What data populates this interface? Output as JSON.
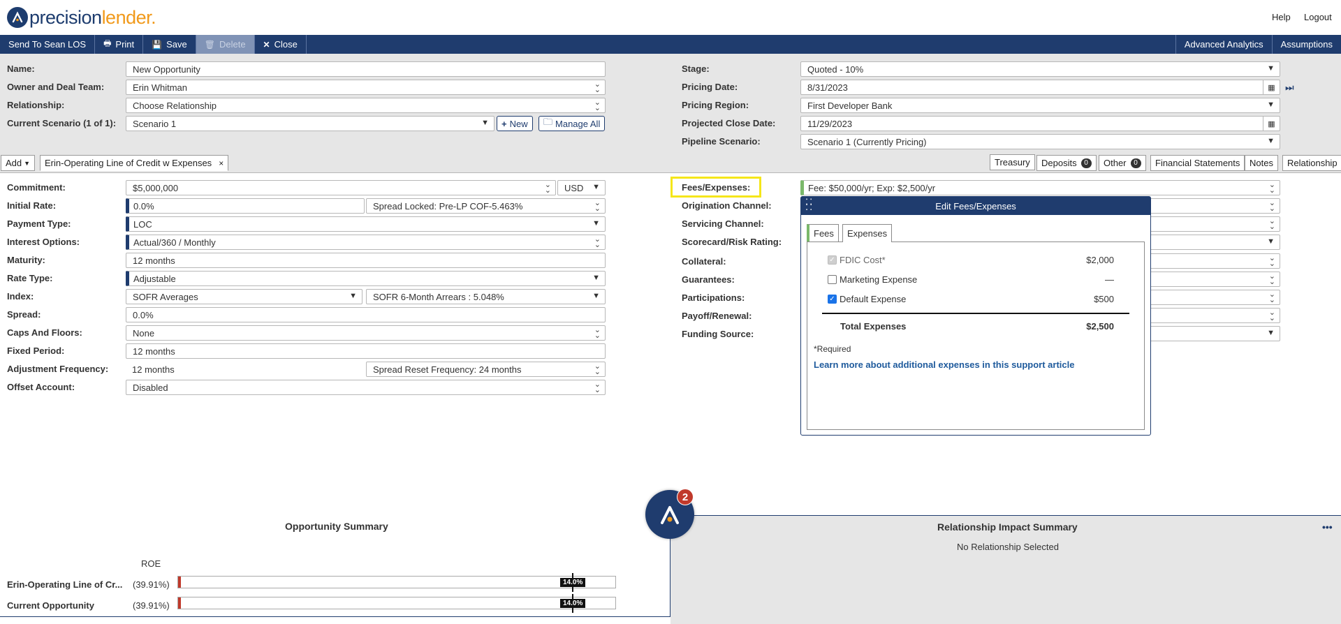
{
  "logo": {
    "part1": "precision",
    "part2": "lender."
  },
  "top_links": {
    "help": "Help",
    "logout": "Logout"
  },
  "toolbar": {
    "send": "Send To Sean LOS",
    "print": "Print",
    "save": "Save",
    "delete": "Delete",
    "close": "Close",
    "advanced_analytics": "Advanced Analytics",
    "assumptions": "Assumptions"
  },
  "header": {
    "name_label": "Name:",
    "name_value": "New Opportunity",
    "owner_label": "Owner and Deal Team:",
    "owner_value": "Erin Whitman",
    "relationship_label": "Relationship:",
    "relationship_value": "Choose Relationship",
    "scenario_label": "Current Scenario (1 of 1):",
    "scenario_value": "Scenario 1",
    "new_button": "New",
    "manage_button": "Manage All",
    "stage_label": "Stage:",
    "stage_value": "Quoted - 10%",
    "pricing_date_label": "Pricing Date:",
    "pricing_date_value": "8/31/2023",
    "pricing_region_label": "Pricing Region:",
    "pricing_region_value": "First Developer Bank",
    "close_date_label": "Projected Close Date:",
    "close_date_value": "11/29/2023",
    "pipeline_label": "Pipeline Scenario:",
    "pipeline_value": "Scenario 1 (Currently Pricing)"
  },
  "tabs": {
    "add": "Add",
    "active_tab": "Erin-Operating Line of Credit w Expenses",
    "treasury": "Treasury",
    "deposits": "Deposits",
    "deposits_count": "0",
    "other": "Other",
    "other_count": "0",
    "financial_statements": "Financial Statements",
    "notes": "Notes",
    "relationship": "Relationship"
  },
  "loan": {
    "commitment_label": "Commitment:",
    "commitment_value": "$5,000,000",
    "currency": "USD",
    "initial_rate_label": "Initial Rate:",
    "initial_rate_value": "0.0%",
    "spread_locked": "Spread Locked: Pre-LP COF-5.463%",
    "payment_type_label": "Payment Type:",
    "payment_type_value": "LOC",
    "interest_options_label": "Interest Options:",
    "interest_options_value": "Actual/360 / Monthly",
    "maturity_label": "Maturity:",
    "maturity_value": "12 months",
    "rate_type_label": "Rate Type:",
    "rate_type_value": "Adjustable",
    "index_label": "Index:",
    "index_value": "SOFR Averages",
    "index_sub_value": "SOFR 6-Month Arrears : 5.048%",
    "spread_label": "Spread:",
    "spread_value": "0.0%",
    "caps_label": "Caps And Floors:",
    "caps_value": "None",
    "fixed_period_label": "Fixed Period:",
    "fixed_period_value": "12 months",
    "adj_freq_label": "Adjustment Frequency:",
    "adj_freq_value": "12 months",
    "spread_reset": "Spread Reset Frequency: 24 months",
    "offset_label": "Offset Account:",
    "offset_value": "Disabled"
  },
  "right_fields": {
    "fees_label": "Fees/Expenses:",
    "fees_value": "Fee: $50,000/yr; Exp: $2,500/yr",
    "origination_label": "Origination Channel:",
    "servicing_label": "Servicing Channel:",
    "scorecard_label": "Scorecard/Risk Rating:",
    "collateral_label": "Collateral:",
    "guarantees_label": "Guarantees:",
    "participations_label": "Participations:",
    "payoff_label": "Payoff/Renewal:",
    "funding_label": "Funding Source:"
  },
  "popup": {
    "title": "Edit Fees/Expenses",
    "tab_fees": "Fees",
    "tab_expenses": "Expenses",
    "expenses": [
      {
        "name": "FDIC Cost*",
        "amount": "$2,000",
        "checked": true,
        "disabled": true
      },
      {
        "name": "Marketing Expense",
        "amount": "—",
        "checked": false,
        "disabled": false
      },
      {
        "name": "Default Expense",
        "amount": "$500",
        "checked": true,
        "disabled": false
      }
    ],
    "total_label": "Total Expenses",
    "total_value": "$2,500",
    "required_note": "*Required",
    "learn_more": "Learn more about additional expenses in this support article"
  },
  "assistant_badge": "2",
  "opportunity_summary": {
    "title": "Opportunity Summary",
    "metric": "ROE",
    "target_roe": 14.0,
    "rows": [
      {
        "name": "Erin-Operating Line of Cr...",
        "value": "(39.91%)",
        "target_label": "14.0%"
      },
      {
        "name": "Current Opportunity",
        "value": "(39.91%)",
        "target_label": "14.0%"
      }
    ]
  },
  "relationship_summary": {
    "title": "Relationship Impact Summary",
    "subtitle": "No Relationship Selected",
    "menu": "•••"
  },
  "colors": {
    "navy": "#1f3c6e",
    "orange": "#f19a1b",
    "highlight": "#f5e61a",
    "negative": "#c0392b"
  }
}
